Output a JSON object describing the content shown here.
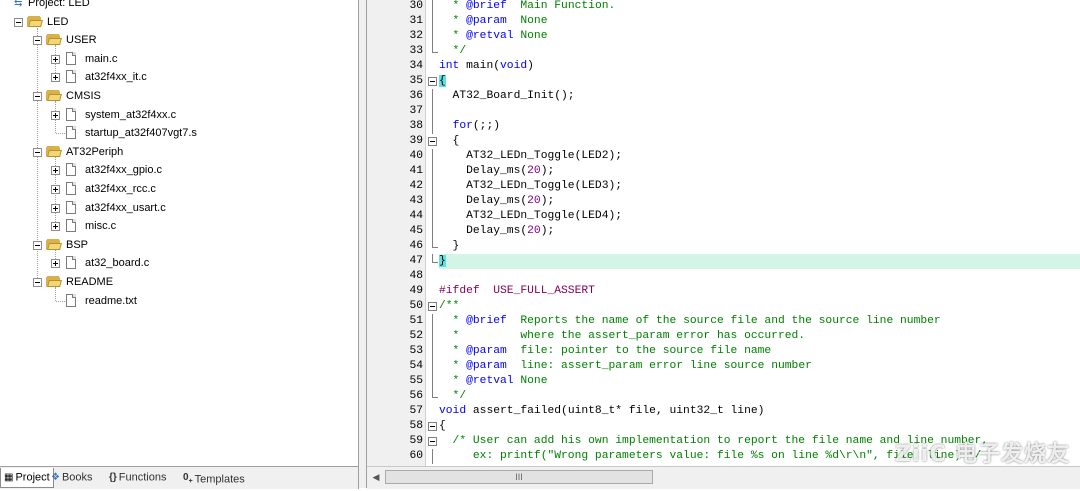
{
  "project_tree": {
    "root_label": "Project: LED",
    "target_label": "LED",
    "groups": [
      {
        "label": "USER",
        "files": [
          "main.c",
          "at32f4xx_it.c"
        ]
      },
      {
        "label": "CMSIS",
        "files": [
          "system_at32f4xx.c",
          "startup_at32f407vgt7.s"
        ]
      },
      {
        "label": "AT32Periph",
        "files": [
          "at32f4xx_gpio.c",
          "at32f4xx_rcc.c",
          "at32f4xx_usart.c",
          "misc.c"
        ]
      },
      {
        "label": "BSP",
        "files": [
          "at32_board.c"
        ]
      },
      {
        "label": "README",
        "files": [
          "readme.txt"
        ]
      }
    ]
  },
  "tabs": [
    {
      "label": "Project",
      "icon": "project-icon",
      "active": true
    },
    {
      "label": "Books",
      "icon": "books-icon",
      "active": false
    },
    {
      "label": "Functions",
      "icon": "functions-icon",
      "active": false
    },
    {
      "label": "Templates",
      "icon": "templates-icon",
      "active": false
    }
  ],
  "editor": {
    "lines": [
      {
        "n": "30",
        "text": "  * @brief  Main Function."
      },
      {
        "n": "31",
        "text": "  * @param  None"
      },
      {
        "n": "32",
        "text": "  * @retval None"
      },
      {
        "n": "33",
        "text": "  */"
      },
      {
        "n": "34",
        "text": "int main(void)"
      },
      {
        "n": "35",
        "text": "{"
      },
      {
        "n": "36",
        "text": "  AT32_Board_Init();"
      },
      {
        "n": "37",
        "text": ""
      },
      {
        "n": "38",
        "text": "  for(;;)"
      },
      {
        "n": "39",
        "text": "  {"
      },
      {
        "n": "40",
        "text": "    AT32_LEDn_Toggle(LED2);"
      },
      {
        "n": "41",
        "text": "    Delay_ms(20);"
      },
      {
        "n": "42",
        "text": "    AT32_LEDn_Toggle(LED3);"
      },
      {
        "n": "43",
        "text": "    Delay_ms(20);"
      },
      {
        "n": "44",
        "text": "    AT32_LEDn_Toggle(LED4);"
      },
      {
        "n": "45",
        "text": "    Delay_ms(20);"
      },
      {
        "n": "46",
        "text": "  }"
      },
      {
        "n": "47",
        "text": "}"
      },
      {
        "n": "48",
        "text": ""
      },
      {
        "n": "49",
        "text": "#ifdef  USE_FULL_ASSERT"
      },
      {
        "n": "50",
        "text": "/**"
      },
      {
        "n": "51",
        "text": "  * @brief  Reports the name of the source file and the source line number"
      },
      {
        "n": "52",
        "text": "  *         where the assert_param error has occurred."
      },
      {
        "n": "53",
        "text": "  * @param  file: pointer to the source file name"
      },
      {
        "n": "54",
        "text": "  * @param  line: assert_param error line source number"
      },
      {
        "n": "55",
        "text": "  * @retval None"
      },
      {
        "n": "56",
        "text": "  */"
      },
      {
        "n": "57",
        "text": "void assert_failed(uint8_t* file, uint32_t line)"
      },
      {
        "n": "58",
        "text": "{"
      },
      {
        "n": "59",
        "text": "  /* User can add his own implementation to report the file name and line number,"
      },
      {
        "n": "60",
        "text": "     ex: printf(\"Wrong parameters value: file %s on line %d\\r\\n\", file, line) */"
      }
    ]
  },
  "scrollbar": {
    "thumb_label": "III"
  },
  "watermark": "ZiiC 电子发烧友",
  "colors": {
    "comment": "#008000",
    "keyword": "#0000ff",
    "number": "#800080",
    "current_line": "#d3f5e8",
    "brace_match": "#5fe0e0"
  }
}
